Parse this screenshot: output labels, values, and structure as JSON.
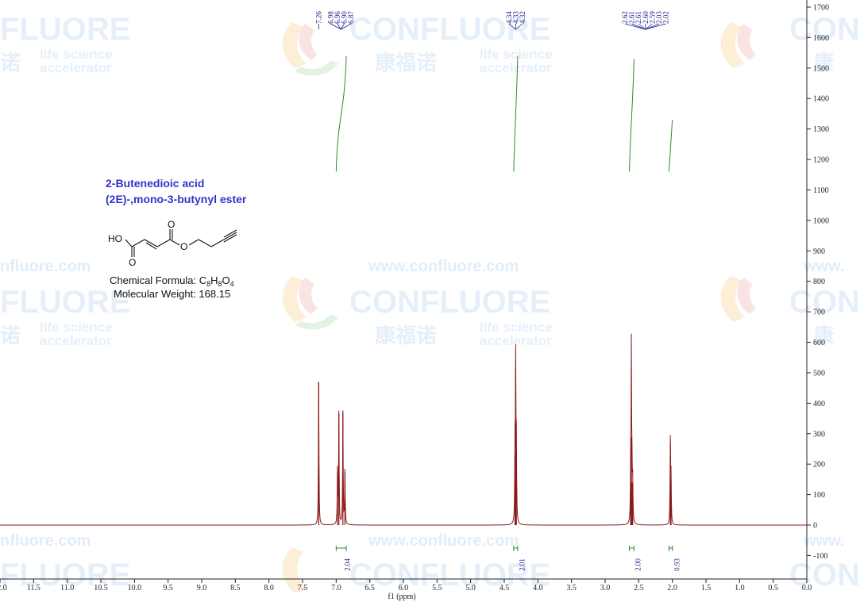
{
  "compound": {
    "name_line1": "2-Butenedioic acid",
    "name_line2": "(2E)-,mono-3-butynyl ester",
    "formula_label": "Chemical Formula: ",
    "formula": "C8H8O4",
    "formula_parts": [
      {
        "text": "C",
        "sub": false
      },
      {
        "text": "8",
        "sub": true
      },
      {
        "text": "H",
        "sub": false
      },
      {
        "text": "8",
        "sub": true
      },
      {
        "text": "O",
        "sub": false
      },
      {
        "text": "4",
        "sub": true
      }
    ],
    "weight": "Molecular Weight: 168.15",
    "atoms": {
      "ho": "HO",
      "o1": "O",
      "o2": "O",
      "o3": "O"
    }
  },
  "watermark": {
    "brand": "CONFLUORE",
    "brand_partial": "FLUORE",
    "brand_partial2": "CON",
    "cn": "康福诺",
    "cn_partial": "诺",
    "cn_partial2": "康",
    "line1": "life science",
    "line2": "accelerator",
    "url": "www.confluore.com",
    "url_partial": "nfluore.com",
    "url_partial2": "www."
  },
  "chart_data": {
    "type": "line",
    "xlabel": "f1 (ppm)",
    "ylabel": "",
    "xlim": [
      12.0,
      0.0
    ],
    "ylim": [
      -160,
      1720
    ],
    "x_ticks": [
      "12.0",
      "11.5",
      "11.0",
      "10.5",
      "10.0",
      "9.5",
      "9.0",
      "8.5",
      "8.0",
      "7.5",
      "7.0",
      "6.5",
      "6.0",
      "5.5",
      "5.0",
      "4.5",
      "4.0",
      "3.5",
      "3.0",
      "2.5",
      "2.0",
      "1.5",
      "1.0",
      "0.5",
      "0.0"
    ],
    "y_ticks": [
      "1700",
      "1600",
      "1500",
      "1400",
      "1300",
      "1200",
      "1100",
      "1000",
      "900",
      "800",
      "700",
      "600",
      "500",
      "400",
      "300",
      "200",
      "100",
      "0",
      "-100"
    ],
    "spectrum_color": "#8b1a1a",
    "integral_color": "#2e8b2e",
    "label_color": "#1a1a8c",
    "peaks": [
      {
        "ppm": 7.26,
        "height": 470
      },
      {
        "ppm": 6.98,
        "height": 175
      },
      {
        "ppm": 6.96,
        "height": 365
      },
      {
        "ppm": 6.9,
        "height": 370
      },
      {
        "ppm": 6.87,
        "height": 175
      },
      {
        "ppm": 4.34,
        "height": 230
      },
      {
        "ppm": 4.33,
        "height": 515
      },
      {
        "ppm": 4.32,
        "height": 235
      },
      {
        "ppm": 2.62,
        "height": 140
      },
      {
        "ppm": 2.61,
        "height": 285
      },
      {
        "ppm": 2.61,
        "height": 290
      },
      {
        "ppm": 2.6,
        "height": 140
      },
      {
        "ppm": 2.59,
        "height": 130
      },
      {
        "ppm": 2.03,
        "height": 270
      },
      {
        "ppm": 2.02,
        "height": 150
      }
    ],
    "peak_label_groups": [
      {
        "labels": [
          "7.26"
        ],
        "center_ppm": 7.26
      },
      {
        "labels": [
          "6.98",
          "6.96",
          "6.90",
          "6.87"
        ],
        "center_ppm": 6.93
      },
      {
        "labels": [
          "4.34",
          "4.33",
          "4.32"
        ],
        "center_ppm": 4.33
      },
      {
        "labels": [
          "2.62",
          "2.61",
          "2.61",
          "2.60",
          "2.59",
          "2.03",
          "2.02"
        ],
        "center_ppm": 2.4
      }
    ],
    "integrals": [
      {
        "from": 7.0,
        "to": 6.85,
        "value": "2.04",
        "y_start": 1160,
        "y_end": 1540
      },
      {
        "from": 4.36,
        "to": 4.3,
        "value": "2.01",
        "y_start": 1160,
        "y_end": 1540
      },
      {
        "from": 2.64,
        "to": 2.57,
        "value": "2.00",
        "y_start": 1160,
        "y_end": 1530
      },
      {
        "from": 2.05,
        "to": 2.0,
        "value": "0.93",
        "y_start": 1160,
        "y_end": 1330
      }
    ]
  }
}
